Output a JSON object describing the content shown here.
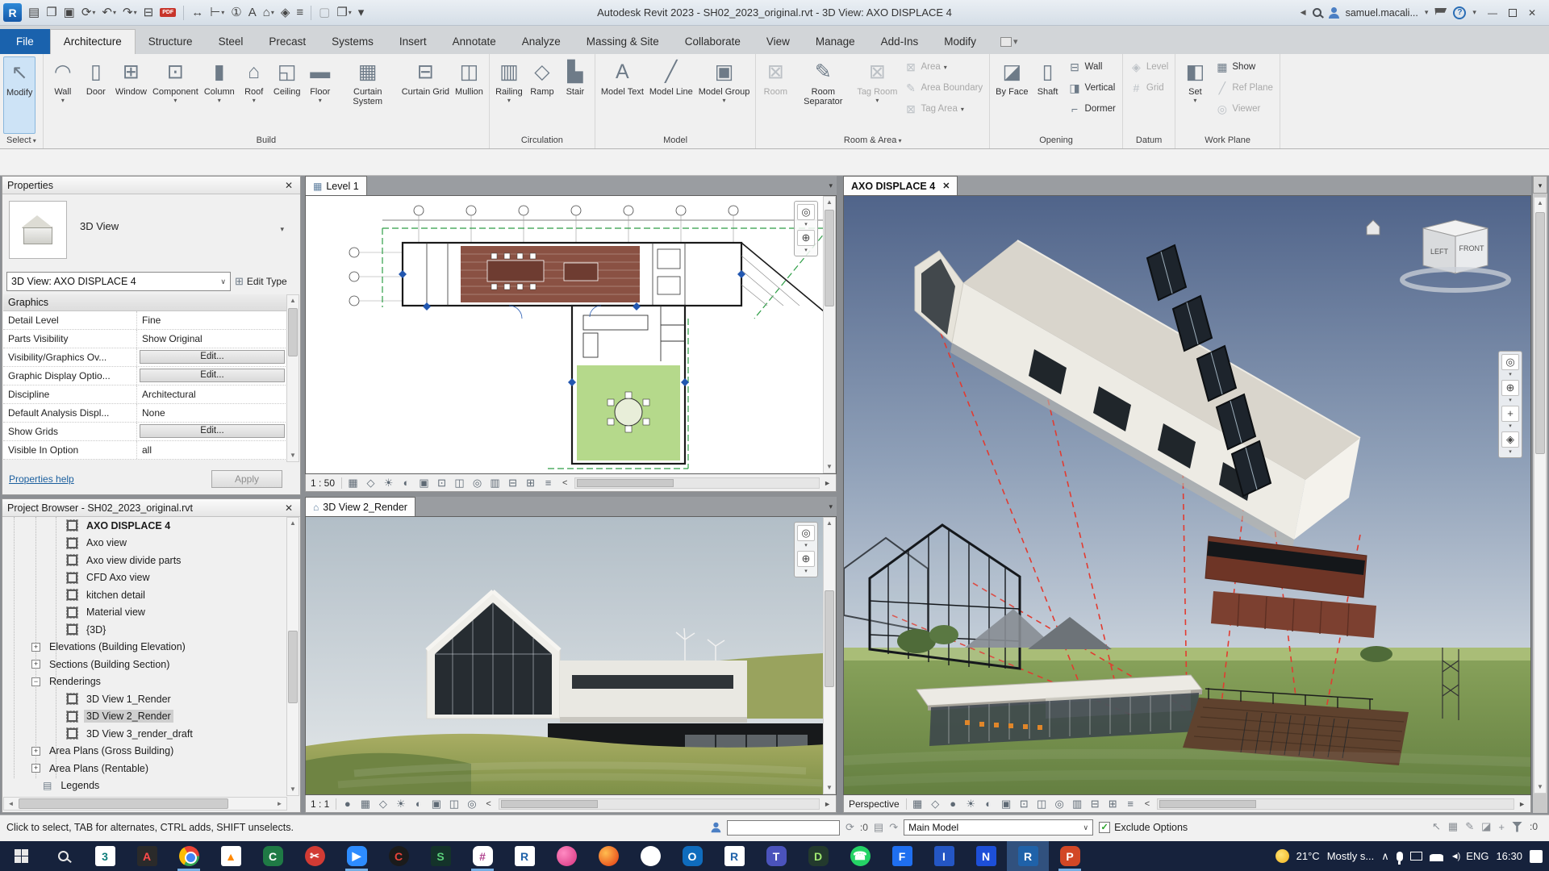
{
  "window": {
    "title": "Autodesk Revit 2023 - SH02_2023_original.rvt - 3D View: AXO DISPLACE 4",
    "user": "samuel.macali...",
    "logo": "R"
  },
  "qat": [
    {
      "name": "file-menu",
      "glyph": "▤"
    },
    {
      "name": "open",
      "glyph": "❐"
    },
    {
      "name": "save",
      "glyph": "▣"
    },
    {
      "name": "sync-with-central",
      "glyph": "⟳",
      "arrow": true
    },
    {
      "name": "undo",
      "glyph": "↶",
      "arrow": true
    },
    {
      "name": "redo",
      "glyph": "↷",
      "arrow": true
    },
    {
      "name": "print",
      "glyph": "⊟"
    },
    {
      "name": "export-pdf",
      "glyph": "PDF",
      "pdf": true,
      "sep_after": true
    },
    {
      "name": "measure",
      "glyph": "↔"
    },
    {
      "name": "aligned-dimension",
      "glyph": "⊢",
      "arrow": true
    },
    {
      "name": "tag-by-category",
      "glyph": "①"
    },
    {
      "name": "text-note",
      "glyph": "A"
    },
    {
      "name": "default-3d-view",
      "glyph": "⌂",
      "arrow": true
    },
    {
      "name": "section",
      "glyph": "◈"
    },
    {
      "name": "thin-lines",
      "glyph": "≡",
      "sep_after": true
    },
    {
      "name": "close-hidden-windows",
      "glyph": "▢",
      "disabled": true
    },
    {
      "name": "switch-windows",
      "glyph": "❐",
      "arrow": true
    },
    {
      "name": "customize-qat",
      "glyph": "▾"
    }
  ],
  "tabs": [
    {
      "label": "File",
      "file": true
    },
    {
      "label": "Architecture",
      "active": true
    },
    {
      "label": "Structure"
    },
    {
      "label": "Steel"
    },
    {
      "label": "Precast"
    },
    {
      "label": "Systems"
    },
    {
      "label": "Insert"
    },
    {
      "label": "Annotate"
    },
    {
      "label": "Analyze"
    },
    {
      "label": "Massing & Site"
    },
    {
      "label": "Collaborate"
    },
    {
      "label": "View"
    },
    {
      "label": "Manage"
    },
    {
      "label": "Add-Ins"
    },
    {
      "label": "Modify"
    }
  ],
  "ribbon": {
    "groups": [
      {
        "label": "Select",
        "arrow": true,
        "items": [
          {
            "type": "big",
            "label": "Modify",
            "glyph": "↖",
            "selected": true
          }
        ]
      },
      {
        "label": "Build",
        "items": [
          {
            "type": "big",
            "label": "Wall",
            "glyph": "◠",
            "arrow": true
          },
          {
            "type": "big",
            "label": "Door",
            "glyph": "▯"
          },
          {
            "type": "big",
            "label": "Window",
            "glyph": "⊞"
          },
          {
            "type": "big",
            "label": "Component",
            "glyph": "⊡",
            "arrow": true
          },
          {
            "type": "big",
            "label": "Column",
            "glyph": "▮",
            "arrow": true
          },
          {
            "type": "big",
            "label": "Roof",
            "glyph": "⌂",
            "arrow": true
          },
          {
            "type": "big",
            "label": "Ceiling",
            "glyph": "◱"
          },
          {
            "type": "big",
            "label": "Floor",
            "glyph": "▬",
            "arrow": true
          },
          {
            "type": "big",
            "label": "Curtain System",
            "glyph": "▦"
          },
          {
            "type": "big",
            "label": "Curtain Grid",
            "glyph": "⊟"
          },
          {
            "type": "big",
            "label": "Mullion",
            "glyph": "◫"
          }
        ]
      },
      {
        "label": "Circulation",
        "items": [
          {
            "type": "big",
            "label": "Railing",
            "glyph": "▥",
            "arrow": true
          },
          {
            "type": "big",
            "label": "Ramp",
            "glyph": "◇"
          },
          {
            "type": "big",
            "label": "Stair",
            "glyph": "▙"
          }
        ]
      },
      {
        "label": "Model",
        "items": [
          {
            "type": "big",
            "label": "Model Text",
            "glyph": "A"
          },
          {
            "type": "big",
            "label": "Model Line",
            "glyph": "╱"
          },
          {
            "type": "big",
            "label": "Model Group",
            "glyph": "▣",
            "arrow": true
          }
        ]
      },
      {
        "label": "Room & Area",
        "arrow": true,
        "items": [
          {
            "type": "big",
            "label": "Room",
            "glyph": "⊠",
            "disabled": true
          },
          {
            "type": "big",
            "label": "Room Separator",
            "glyph": "✎"
          },
          {
            "type": "big",
            "label": "Tag Room",
            "glyph": "⊠",
            "arrow": true,
            "disabled": true
          },
          {
            "type": "stack",
            "items": [
              {
                "label": "Area",
                "glyph": "⊠",
                "arrow": true,
                "disabled": true
              },
              {
                "label": "Area Boundary",
                "glyph": "✎",
                "disabled": true
              },
              {
                "label": "Tag Area",
                "glyph": "⊠",
                "arrow": true,
                "disabled": true
              }
            ]
          }
        ]
      },
      {
        "label": "Opening",
        "items": [
          {
            "type": "big",
            "label": "By Face",
            "glyph": "◪"
          },
          {
            "type": "big",
            "label": "Shaft",
            "glyph": "▯"
          },
          {
            "type": "stack",
            "items": [
              {
                "label": "Wall",
                "glyph": "⊟"
              },
              {
                "label": "Vertical",
                "glyph": "◨"
              },
              {
                "label": "Dormer",
                "glyph": "⌐"
              }
            ]
          }
        ]
      },
      {
        "label": "Datum",
        "items": [
          {
            "type": "stack",
            "items": [
              {
                "label": "Level",
                "glyph": "◈",
                "disabled": true
              },
              {
                "label": "Grid",
                "glyph": "#",
                "disabled": true
              }
            ]
          }
        ]
      },
      {
        "label": "Work Plane",
        "items": [
          {
            "type": "big",
            "label": "Set",
            "glyph": "◧",
            "arrow": true
          },
          {
            "type": "stack",
            "items": [
              {
                "label": "Show",
                "glyph": "▦"
              },
              {
                "label": "Ref Plane",
                "glyph": "╱",
                "disabled": true
              },
              {
                "label": "Viewer",
                "glyph": "◎",
                "disabled": true
              }
            ]
          }
        ]
      }
    ]
  },
  "properties": {
    "header": "Properties",
    "type_label": "3D View",
    "selector": "3D View: AXO DISPLACE 4",
    "edit_type": "Edit Type",
    "section": "Graphics",
    "rows": [
      {
        "label": "Detail Level",
        "value": "Fine"
      },
      {
        "label": "Parts Visibility",
        "value": "Show Original"
      },
      {
        "label": "Visibility/Graphics Ov...",
        "value": "Edit...",
        "button": true
      },
      {
        "label": "Graphic Display Optio...",
        "value": "Edit...",
        "button": true
      },
      {
        "label": "Discipline",
        "value": "Architectural"
      },
      {
        "label": "Default Analysis Displ...",
        "value": "None"
      },
      {
        "label": "Show Grids",
        "value": "Edit...",
        "button": true
      },
      {
        "label": "Visible In Option",
        "value": "all"
      }
    ],
    "help": "Properties help",
    "apply": "Apply"
  },
  "browser": {
    "header": "Project Browser - SH02_2023_original.rvt",
    "items": [
      {
        "x": 80,
        "icon": "view",
        "label": "AXO DISPLACE 4",
        "bold": true
      },
      {
        "x": 80,
        "icon": "view",
        "label": "Axo view"
      },
      {
        "x": 80,
        "icon": "view",
        "label": "Axo view divide parts"
      },
      {
        "x": 80,
        "icon": "view",
        "label": "CFD Axo view"
      },
      {
        "x": 80,
        "icon": "view",
        "label": "kitchen detail"
      },
      {
        "x": 80,
        "icon": "view",
        "label": "Material view"
      },
      {
        "x": 80,
        "icon": "view",
        "label": "{3D}"
      },
      {
        "x": 36,
        "icon": "plus",
        "label": "Elevations (Building Elevation)"
      },
      {
        "x": 36,
        "icon": "plus",
        "label": "Sections (Building Section)"
      },
      {
        "x": 36,
        "icon": "minus",
        "label": "Renderings"
      },
      {
        "x": 80,
        "icon": "view",
        "label": "3D View 1_Render"
      },
      {
        "x": 80,
        "icon": "view",
        "label": "3D View 2_Render",
        "selected": true
      },
      {
        "x": 80,
        "icon": "view",
        "label": "3D View 3_render_draft"
      },
      {
        "x": 36,
        "icon": "plus",
        "label": "Area Plans (Gross Building)"
      },
      {
        "x": 36,
        "icon": "plus",
        "label": "Area Plans (Rentable)"
      },
      {
        "x": 50,
        "icon": "legend",
        "label": "Legends"
      }
    ]
  },
  "viewports": {
    "plan": {
      "tab": "Level 1"
    },
    "render": {
      "tab": "3D View 2_Render"
    },
    "axon": {
      "tab": "AXO DISPLACE 4",
      "close": "✕",
      "viewcube": {
        "left": "LEFT",
        "front": "FRONT"
      }
    }
  },
  "viewbars": {
    "plan": {
      "scale": "1 : 50",
      "icons": [
        {
          "name": "detail-level-icon",
          "glyph": "▦"
        },
        {
          "name": "visual-style-icon",
          "glyph": "◇"
        },
        {
          "name": "sun-path-icon",
          "glyph": "☀"
        },
        {
          "name": "shadows-icon",
          "glyph": "◐"
        },
        {
          "name": "crop-view-icon",
          "glyph": "▣"
        },
        {
          "name": "crop-visibility-icon",
          "glyph": "⊡"
        },
        {
          "name": "temporary-hide-isolate-icon",
          "glyph": "◫"
        },
        {
          "name": "reveal-hidden-elements-icon",
          "glyph": "◎"
        },
        {
          "name": "temporary-view-properties-icon",
          "glyph": "▥"
        },
        {
          "name": "hide-analytical-model-icon",
          "glyph": "⊟"
        },
        {
          "name": "highlight-displacement-icon",
          "glyph": "⊞"
        },
        {
          "name": "reveal-constraints-icon",
          "glyph": "≡"
        }
      ]
    },
    "render": {
      "scale": "1 : 1",
      "icons": [
        {
          "name": "show-rendering-dialog-icon",
          "glyph": "●"
        },
        {
          "name": "detail-level-icon",
          "glyph": "▦"
        },
        {
          "name": "visual-style-icon",
          "glyph": "◇"
        },
        {
          "name": "sun-path-icon",
          "glyph": "☀"
        },
        {
          "name": "shadows-icon",
          "glyph": "◐"
        },
        {
          "name": "crop-view-icon",
          "glyph": "▣"
        },
        {
          "name": "temporary-hide-isolate-icon",
          "glyph": "◫"
        },
        {
          "name": "reveal-hidden-elements-icon",
          "glyph": "◎"
        }
      ]
    },
    "axon": {
      "scale": "Perspective",
      "icons": [
        {
          "name": "detail-level-icon",
          "glyph": "▦"
        },
        {
          "name": "visual-style-icon",
          "glyph": "◇"
        },
        {
          "name": "show-rendering-dialog-icon",
          "glyph": "●"
        },
        {
          "name": "sun-path-icon",
          "glyph": "☀"
        },
        {
          "name": "shadows-icon",
          "glyph": "◐"
        },
        {
          "name": "crop-view-icon",
          "glyph": "▣"
        },
        {
          "name": "crop-visibility-icon",
          "glyph": "⊡"
        },
        {
          "name": "temporary-hide-isolate-icon",
          "glyph": "◫"
        },
        {
          "name": "reveal-hidden-elements-icon",
          "glyph": "◎"
        },
        {
          "name": "temporary-view-properties-icon",
          "glyph": "▥"
        },
        {
          "name": "hide-analytical-model-icon",
          "glyph": "⊟"
        },
        {
          "name": "highlight-displacement-icon",
          "glyph": "⊞"
        },
        {
          "name": "reveal-constraints-icon",
          "glyph": "≡"
        }
      ]
    }
  },
  "navbars": {
    "plan": [
      {
        "name": "steering-wheel-icon",
        "glyph": "◎"
      },
      {
        "name": "zoom-control-icon",
        "glyph": "⊕"
      }
    ],
    "render": [
      {
        "name": "steering-wheel-icon",
        "glyph": "◎"
      },
      {
        "name": "zoom-control-icon",
        "glyph": "⊕"
      }
    ],
    "axon": [
      {
        "name": "steering-wheel-icon",
        "glyph": "◎"
      },
      {
        "name": "zoom-control-icon",
        "glyph": "⊕"
      },
      {
        "name": "pan-icon",
        "glyph": "+"
      },
      {
        "name": "orbit-icon",
        "glyph": "◈"
      }
    ]
  },
  "status": {
    "hint": "Click to select, TAB for alternates, CTRL adds, SHIFT unselects.",
    "workset_value": "",
    "requests_count": ":0",
    "design_option": "Main Model",
    "exclude_label": "Exclude Options",
    "check": "✓",
    "right_icons": [
      {
        "name": "select-links-toggle",
        "glyph": "↖"
      },
      {
        "name": "select-underlay-elements-toggle",
        "glyph": "▦"
      },
      {
        "name": "select-pinned-elements-toggle",
        "glyph": "✎"
      },
      {
        "name": "select-elements-by-face-toggle",
        "glyph": "◪"
      },
      {
        "name": "drag-elements-on-selection-toggle",
        "glyph": "+"
      }
    ],
    "selection_count": ":0"
  },
  "taskbar": {
    "apps": [
      {
        "name": "3ds-max",
        "letter": "3",
        "bg": "#ffffff",
        "fg": "#0c7c7a",
        "shape": "square"
      },
      {
        "name": "adobe-acrobat",
        "letter": "A",
        "bg": "#2a2a2a",
        "fg": "#ff4b4b",
        "shape": "square"
      },
      {
        "name": "chrome",
        "letter": "",
        "shape": "chrome",
        "running": true
      },
      {
        "name": "vlc",
        "letter": "▲",
        "bg": "#ffffff",
        "fg": "#ff8800",
        "shape": "square"
      },
      {
        "name": "camtasia",
        "letter": "C",
        "bg": "#1f7a45",
        "fg": "#ffffff",
        "shape": "rounded"
      },
      {
        "name": "screen-snip",
        "letter": "✂",
        "bg": "#d23b34",
        "fg": "#ffffff",
        "shape": "circle"
      },
      {
        "name": "zoom",
        "letter": "▶",
        "bg": "#2d8cff",
        "fg": "#ffffff",
        "shape": "rounded",
        "running": true
      },
      {
        "name": "ccleaner",
        "letter": "C",
        "bg": "#1b1b1b",
        "fg": "#e8443a",
        "shape": "circle"
      },
      {
        "name": "sharex",
        "letter": "S",
        "bg": "#14332a",
        "fg": "#5ad07a",
        "shape": "square"
      },
      {
        "name": "slack",
        "letter": "#",
        "bg": "#ffffff",
        "fg": "#b0418e",
        "shape": "rounded",
        "running": true
      },
      {
        "name": "revit-1",
        "letter": "R",
        "bg": "#ffffff",
        "fg": "#1f62a9",
        "shape": "square"
      },
      {
        "name": "photos-app",
        "letter": "",
        "shape": "pink"
      },
      {
        "name": "firefox",
        "letter": "",
        "shape": "fox"
      },
      {
        "name": "signal",
        "letter": "",
        "bg": "#ffffff",
        "fg": "#3a76f0",
        "shape": "circle"
      },
      {
        "name": "outlook",
        "letter": "O",
        "bg": "#0f6cbd",
        "fg": "#ffffff",
        "shape": "rounded"
      },
      {
        "name": "revit-2",
        "letter": "R",
        "bg": "#ffffff",
        "fg": "#1f62a9",
        "shape": "square"
      },
      {
        "name": "teams",
        "letter": "T",
        "bg": "#4b53bc",
        "fg": "#ffffff",
        "shape": "rounded"
      },
      {
        "name": "davinci",
        "letter": "D",
        "bg": "#233a2d",
        "fg": "#9fe870",
        "shape": "rounded"
      },
      {
        "name": "whatsapp",
        "letter": "☎",
        "bg": "#25d366",
        "fg": "#ffffff",
        "shape": "circle"
      },
      {
        "name": "filmora",
        "letter": "F",
        "bg": "#1f6ff0",
        "fg": "#ffffff",
        "shape": "square"
      },
      {
        "name": "illustrator-alt",
        "letter": "I",
        "bg": "#2456c4",
        "fg": "#ffffff",
        "shape": "square"
      },
      {
        "name": "notepad-alt",
        "letter": "N",
        "bg": "#1d4fd8",
        "fg": "#ffffff",
        "shape": "square"
      },
      {
        "name": "revit-active",
        "letter": "R",
        "bg": "#1f62a9",
        "fg": "#ffffff",
        "shape": "square",
        "active": true,
        "running": true
      },
      {
        "name": "powerpoint",
        "letter": "P",
        "bg": "#d24726",
        "fg": "#ffffff",
        "shape": "rounded",
        "running": true
      }
    ],
    "weather_temp": "21°C",
    "weather_text": "Mostly s...",
    "chevron": "∧",
    "volume_glyph": "◄)",
    "lang": "ENG",
    "time": "16:30"
  }
}
